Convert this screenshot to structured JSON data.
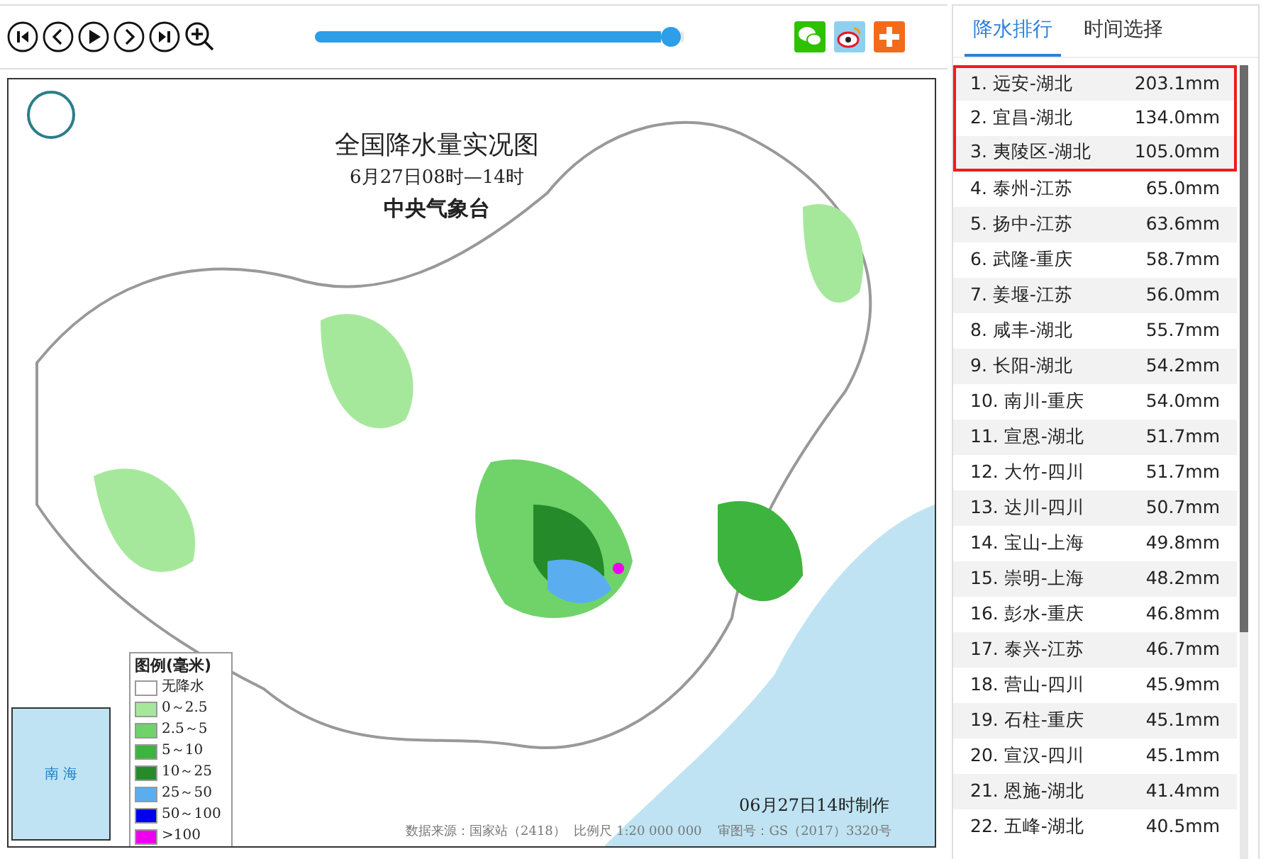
{
  "toolbar": {
    "buttons": [
      {
        "kind": "first"
      },
      {
        "kind": "prev"
      },
      {
        "kind": "play"
      },
      {
        "kind": "next"
      },
      {
        "kind": "last"
      },
      {
        "kind": "zoom"
      }
    ],
    "slider": {
      "level": 0.99
    },
    "share": [
      {
        "kind": "wechat"
      },
      {
        "kind": "weibo"
      },
      {
        "kind": "more"
      }
    ]
  },
  "map": {
    "title": "全国降水量实况图",
    "subtitle": "6月27日08时—14时",
    "issuer": "中央气象台",
    "legend": {
      "title": "图例(毫米)",
      "items": [
        {
          "label": "无降水",
          "color": "#ffffff"
        },
        {
          "label": "0～2.5",
          "color": "#a6e89b"
        },
        {
          "label": "2.5～5",
          "color": "#6fd36a"
        },
        {
          "label": "5～10",
          "color": "#3db43d"
        },
        {
          "label": "10～25",
          "color": "#258b2a"
        },
        {
          "label": "25～50",
          "color": "#5aaef0"
        },
        {
          "label": "50～100",
          "color": "#0000ee"
        },
        {
          "label": ">100",
          "color": "#ee00ee"
        }
      ]
    },
    "stamp": "06月27日14时制作",
    "credits": "数据来源：国家站（2418）  比例尺 1:20 000 000    审图号：GS（2017）3320号",
    "inset_label": "南  海"
  },
  "tabs": [
    {
      "label": "降水排行",
      "selected": true
    },
    {
      "label": "时间选择",
      "selected": false
    }
  ],
  "ranking": [
    {
      "name": "1. 远安-湖北",
      "value": "203.1mm",
      "highlighted": true
    },
    {
      "name": "2. 宜昌-湖北",
      "value": "134.0mm",
      "highlighted": true
    },
    {
      "name": "3. 夷陵区-湖北",
      "value": "105.0mm",
      "highlighted": true
    },
    {
      "name": "4. 泰州-江苏",
      "value": "65.0mm",
      "highlighted": false
    },
    {
      "name": "5. 扬中-江苏",
      "value": "63.6mm",
      "highlighted": false
    },
    {
      "name": "6. 武隆-重庆",
      "value": "58.7mm",
      "highlighted": false
    },
    {
      "name": "7. 姜堰-江苏",
      "value": "56.0mm",
      "highlighted": false
    },
    {
      "name": "8. 咸丰-湖北",
      "value": "55.7mm",
      "highlighted": false
    },
    {
      "name": "9. 长阳-湖北",
      "value": "54.2mm",
      "highlighted": false
    },
    {
      "name": "10. 南川-重庆",
      "value": "54.0mm",
      "highlighted": false
    },
    {
      "name": "11. 宣恩-湖北",
      "value": "51.7mm",
      "highlighted": false
    },
    {
      "name": "12. 大竹-四川",
      "value": "51.7mm",
      "highlighted": false
    },
    {
      "name": "13. 达川-四川",
      "value": "50.7mm",
      "highlighted": false
    },
    {
      "name": "14. 宝山-上海",
      "value": "49.8mm",
      "highlighted": false
    },
    {
      "name": "15. 崇明-上海",
      "value": "48.2mm",
      "highlighted": false
    },
    {
      "name": "16. 彭水-重庆",
      "value": "46.8mm",
      "highlighted": false
    },
    {
      "name": "17. 泰兴-江苏",
      "value": "46.7mm",
      "highlighted": false
    },
    {
      "name": "18. 营山-四川",
      "value": "45.9mm",
      "highlighted": false
    },
    {
      "name": "19. 石柱-重庆",
      "value": "45.1mm",
      "highlighted": false
    },
    {
      "name": "20. 宣汉-四川",
      "value": "45.1mm",
      "highlighted": false
    },
    {
      "name": "21. 恩施-湖北",
      "value": "41.4mm",
      "highlighted": false
    },
    {
      "name": "22. 五峰-湖北",
      "value": "40.5mm",
      "highlighted": false
    }
  ]
}
